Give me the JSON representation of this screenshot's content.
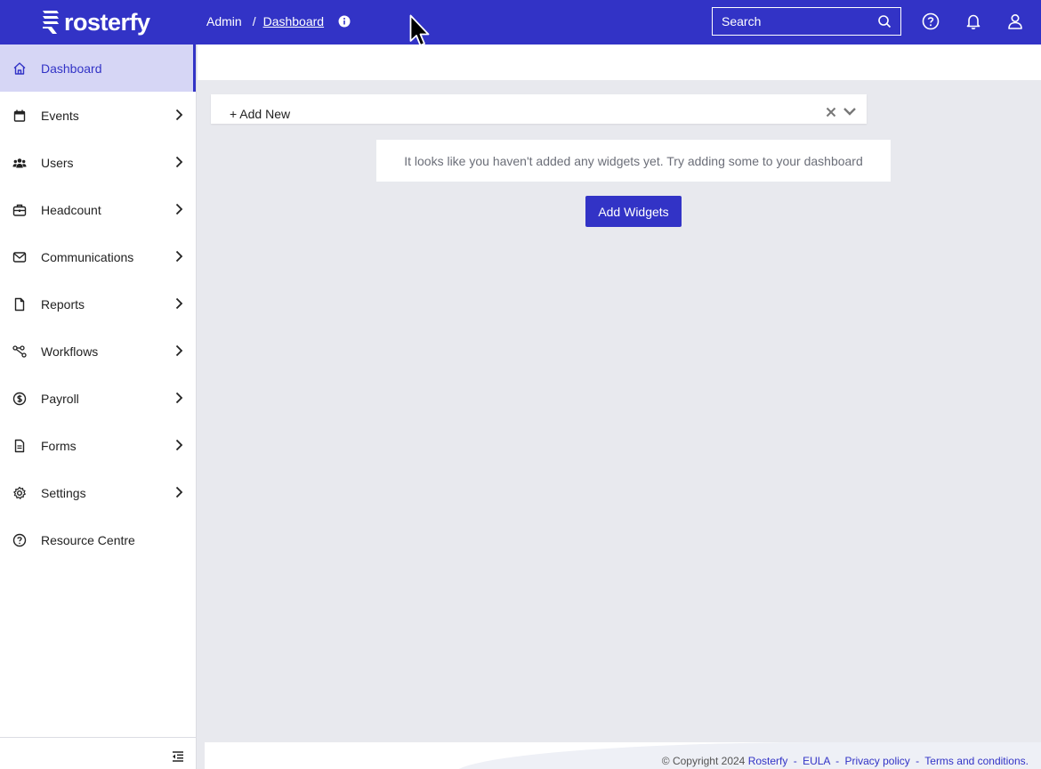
{
  "header": {
    "logo_text": "rosterfy",
    "breadcrumb_root": "Admin",
    "breadcrumb_separator": "/",
    "breadcrumb_current": "Dashboard",
    "search_placeholder": "Search",
    "icons": [
      "info-icon",
      "search-icon",
      "help-icon",
      "bell-icon",
      "user-icon"
    ]
  },
  "sidebar": {
    "items": [
      {
        "label": "Dashboard",
        "icon": "home-icon",
        "active": true
      },
      {
        "label": "Events",
        "icon": "calendar-icon"
      },
      {
        "label": "Users",
        "icon": "users-icon"
      },
      {
        "label": "Headcount",
        "icon": "briefcase-icon"
      },
      {
        "label": "Communications",
        "icon": "mail-icon"
      },
      {
        "label": "Reports",
        "icon": "file-icon"
      },
      {
        "label": "Workflows",
        "icon": "workflow-icon"
      },
      {
        "label": "Payroll",
        "icon": "dollar-icon"
      },
      {
        "label": "Forms",
        "icon": "form-icon"
      },
      {
        "label": "Settings",
        "icon": "gear-icon"
      },
      {
        "label": "Resource Centre",
        "icon": "help-circle-icon"
      }
    ]
  },
  "main": {
    "add_new_label": "+ Add New",
    "empty_message": "It looks like you haven't added any widgets yet. Try adding some to your dashboard",
    "add_widgets_label": "Add Widgets"
  },
  "footer": {
    "copyright": "© Copyright 2024",
    "brand": "Rosterfy",
    "sep": "-",
    "eula": "EULA",
    "privacy": "Privacy policy",
    "terms": "Terms and conditions."
  },
  "colors": {
    "brand": "#3233c6",
    "active_bg": "#d6d6f5",
    "page_bg": "#e8e9ee"
  }
}
